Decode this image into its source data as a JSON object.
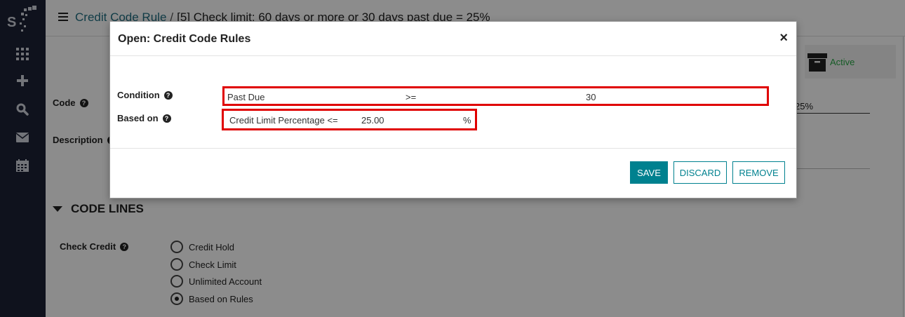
{
  "header": {
    "breadcrumb_link": "Credit Code Rule",
    "breadcrumb_sep": "/",
    "breadcrumb_current": "[5] Check limit: 60 days or more or 30 days past due = 25%"
  },
  "form": {
    "status": "Active",
    "code_label": "Code",
    "code_value_suffix": "25%",
    "description_label": "Description",
    "section_title": "CODE LINES",
    "check_credit_label": "Check Credit",
    "check_credit_options": [
      {
        "label": "Credit Hold",
        "checked": false
      },
      {
        "label": "Check Limit",
        "checked": false
      },
      {
        "label": "Unlimited Account",
        "checked": false
      },
      {
        "label": "Based on Rules",
        "checked": true
      }
    ]
  },
  "modal": {
    "title": "Open: Credit Code Rules",
    "close": "×",
    "condition_label": "Condition",
    "condition": {
      "field": "Past Due",
      "operator": ">=",
      "value": "30"
    },
    "based_on_label": "Based on",
    "based_on": {
      "field": "Credit Limit Percentage <=",
      "value": "25.00",
      "unit": "%"
    },
    "buttons": {
      "save": "SAVE",
      "discard": "DISCARD",
      "remove": "REMOVE"
    }
  },
  "colors": {
    "sidebar": "#1d2235",
    "accent": "#00818f",
    "link": "#1f6e81",
    "highlight": "#e00000",
    "active": "#28a745"
  },
  "icons": {
    "help": "?"
  }
}
